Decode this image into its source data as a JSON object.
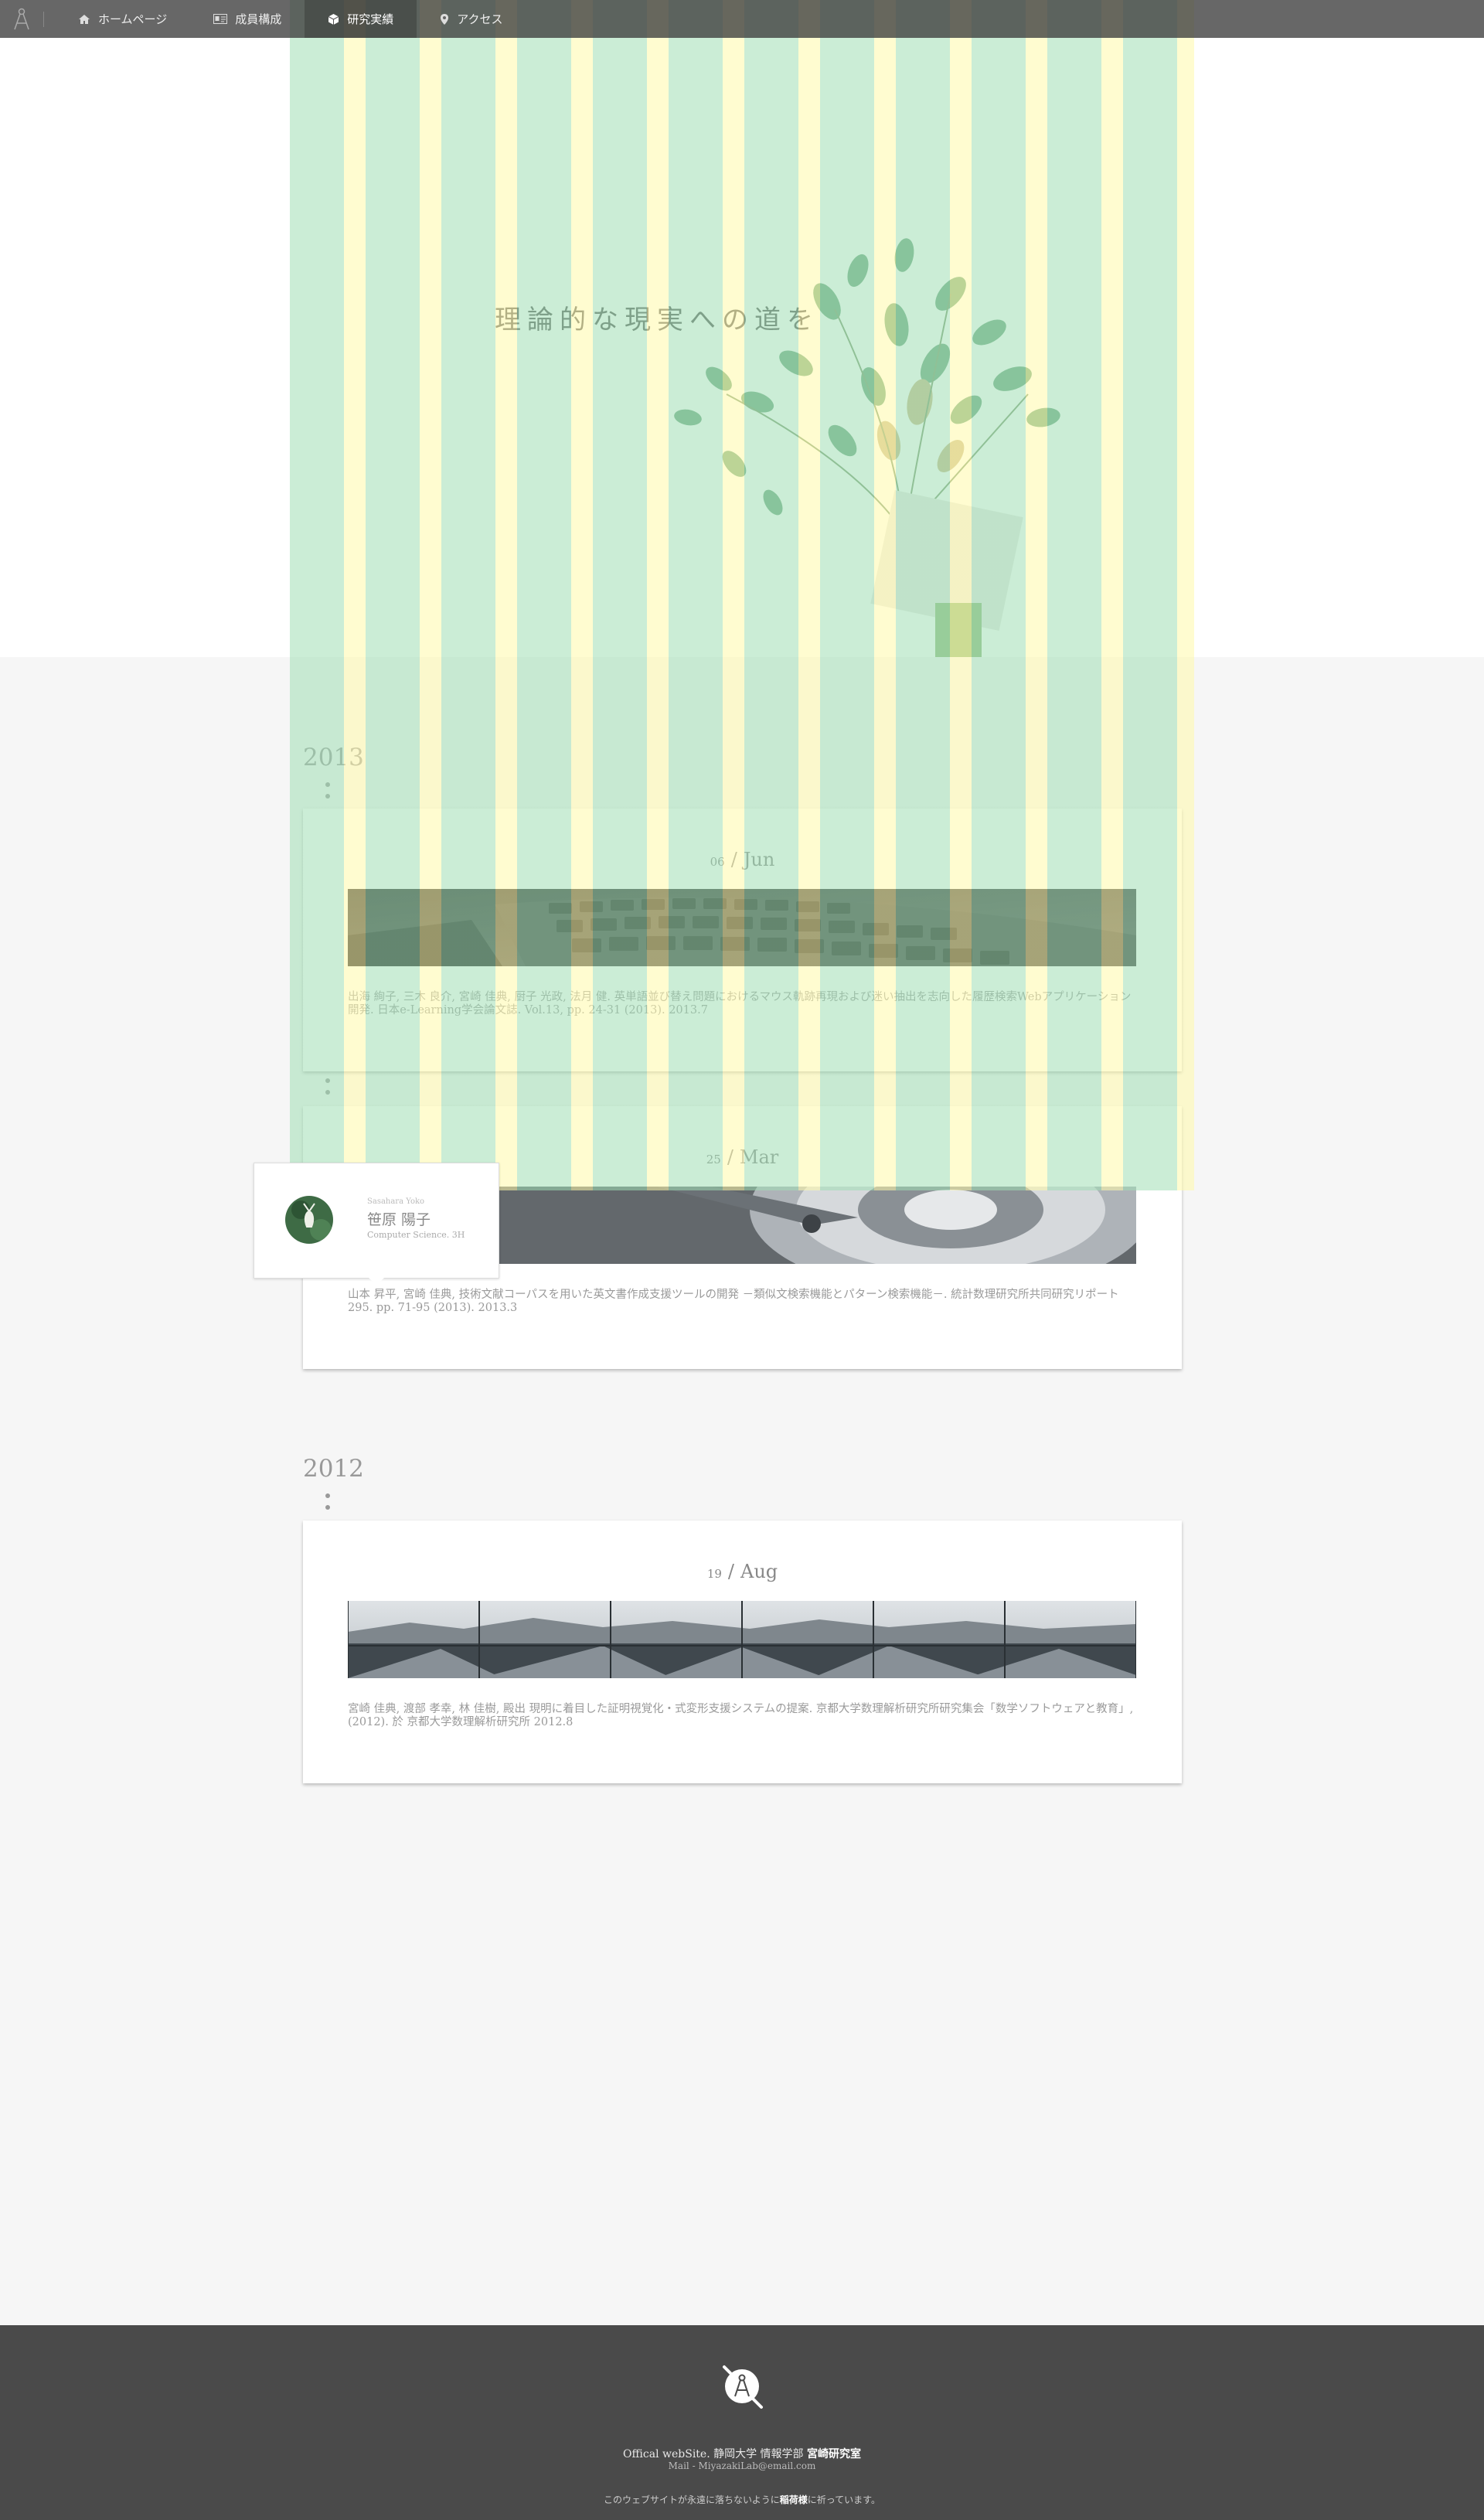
{
  "nav": {
    "items": [
      {
        "label": "ホームページ",
        "icon": "home-icon"
      },
      {
        "label": "成員構成",
        "icon": "id-card-icon"
      },
      {
        "label": "研究実績",
        "icon": "cube-icon"
      },
      {
        "label": "アクセス",
        "icon": "map-marker-icon"
      }
    ],
    "active_index": 2
  },
  "hero": {
    "title": "理論的な現実への道を"
  },
  "timeline": [
    {
      "year": "2013",
      "entries": [
        {
          "day": "06",
          "month": "Jun",
          "image": "keyboard-photo",
          "text": "出海 絢子, 三木 良介, 宮崎 佳典, 厨子 光政, 法月 健. 英単語並び替え問題におけるマウス軌跡再現および迷い抽出を志向した履歴検索Webアプリケーション開発. 日本e-Learning学会論文誌. Vol.13, pp. 24-31 (2013). 2013.7"
        },
        {
          "day": "25",
          "month": "Mar",
          "image": "hard-disk-photo",
          "text": "山本 昇平, 宮崎 佳典, 技術文献コーパスを用いた英文書作成支援ツールの開発 －類似文検索機能とパターン検索機能－. 統計数理研究所共同研究リポート 295. pp. 71-95 (2013). 2013.3"
        }
      ]
    },
    {
      "year": "2012",
      "entries": [
        {
          "day": "19",
          "month": "Aug",
          "image": "glass-roof-photo",
          "text": "宮崎 佳典, 渡部 孝幸, 林 佳樹, 殿出 現明に着目した証明視覚化・式変形支援システムの提案. 京都大学数理解析研究所研究集会「数学ソフトウェアと教育」, (2012). 於 京都大学数理解析研究所 2012.8"
        }
      ]
    }
  ],
  "profile_popup": {
    "roman": "Sasahara Yoko",
    "name": "笹原 陽子",
    "dept": "Computer Science. 3H"
  },
  "footer": {
    "line1_prefix": "Offical webSite. 静岡大学 情報学部 ",
    "line1_bold": "宮崎研究室",
    "line2": "Mail - MiyazakiLab@email.com",
    "line3_prefix": "このウェブサイトが永遠に落ちないように",
    "line3_bold": "稲荷様",
    "line3_suffix": "に祈っています。"
  },
  "colors": {
    "nav_bg": "#3c3c3c",
    "stripe_green": "#a0deb4",
    "stripe_yellow": "#fffaaa",
    "footer_bg": "#4a4a4a",
    "page_bg": "#f6f6f6"
  }
}
